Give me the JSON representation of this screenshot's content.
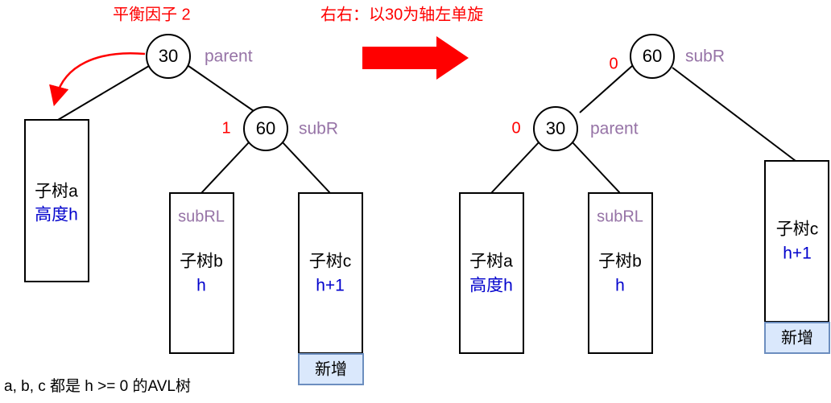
{
  "left": {
    "title": "平衡因子 2",
    "root": {
      "value": "30",
      "role": "parent"
    },
    "child": {
      "value": "60",
      "role": "subR",
      "bf": "1"
    },
    "subtree_a": {
      "title": "子树a",
      "height": "高度h"
    },
    "subtree_b": {
      "role": "subRL",
      "title": "子树b",
      "height": "h"
    },
    "subtree_c": {
      "title": "子树c",
      "height": "h+1",
      "new_label": "新增"
    }
  },
  "arrow": {
    "label": "右右：以30为轴左单旋",
    "color": "#ff0000"
  },
  "right": {
    "root": {
      "value": "60",
      "role": "subR",
      "bf": "0"
    },
    "child": {
      "value": "30",
      "role": "parent",
      "bf": "0"
    },
    "subtree_a": {
      "title": "子树a",
      "height": "高度h"
    },
    "subtree_b": {
      "role": "subRL",
      "title": "子树b",
      "height": "h"
    },
    "subtree_c": {
      "title": "子树c",
      "height": "h+1",
      "new_label": "新增"
    }
  },
  "note": "a, b, c 都是 h >= 0 的AVL树",
  "colors": {
    "role": "#9673a6",
    "height": "#0000cc",
    "balance": "#ff0000",
    "new_fill": "#dae8fc",
    "new_stroke": "#6c8ebf"
  }
}
